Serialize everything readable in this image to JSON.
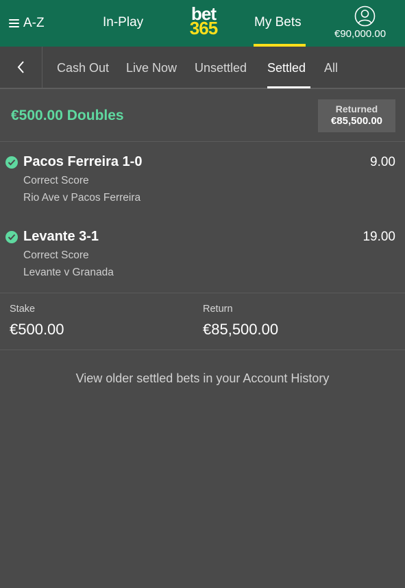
{
  "header": {
    "menu_label": "A-Z",
    "inplay_label": "In-Play",
    "logo_top": "bet",
    "logo_bottom": "365",
    "mybets_label": "My Bets",
    "balance": "€90,000.00"
  },
  "tabs": [
    {
      "label": "Cash Out",
      "active": false
    },
    {
      "label": "Live Now",
      "active": false
    },
    {
      "label": "Unsettled",
      "active": false
    },
    {
      "label": "Settled",
      "active": true
    },
    {
      "label": "All",
      "active": false
    }
  ],
  "bet": {
    "title": "€500.00 Doubles",
    "returned_label": "Returned",
    "returned_amount": "€85,500.00",
    "selections": [
      {
        "name": "Pacos Ferreira 1-0",
        "odds": "9.00",
        "market": "Correct Score",
        "event": "Rio Ave v Pacos Ferreira",
        "status": "won"
      },
      {
        "name": "Levante 3-1",
        "odds": "19.00",
        "market": "Correct Score",
        "event": "Levante v Granada",
        "status": "won"
      }
    ],
    "stake_label": "Stake",
    "stake_value": "€500.00",
    "return_label": "Return",
    "return_value": "€85,500.00"
  },
  "footer_link": "View older settled bets in your Account History",
  "colors": {
    "brand_green": "#126e51",
    "accent_yellow": "#ffdf1b",
    "win_green": "#5fd9a0",
    "background": "#4a4a4a"
  },
  "icons": {
    "menu": "hamburger-icon",
    "account": "user-circle-icon",
    "back": "chevron-left-icon",
    "status": "check-circle-icon"
  }
}
